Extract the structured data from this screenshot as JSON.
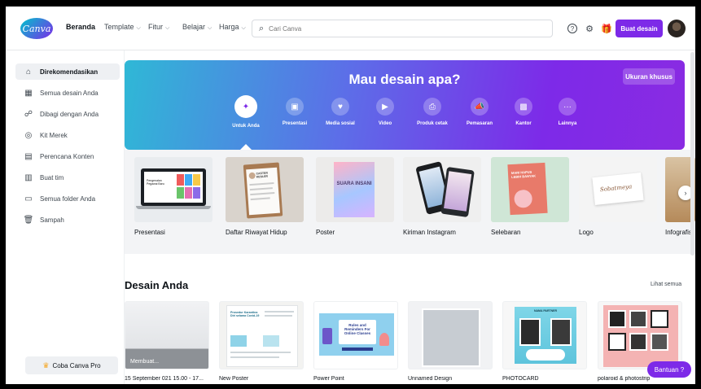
{
  "header": {
    "logo_text": "Canva",
    "nav": [
      {
        "label": "Beranda",
        "chev": ""
      },
      {
        "label": "Template",
        "chev": "⌵"
      },
      {
        "label": "Fitur",
        "chev": "⌵"
      },
      {
        "label": "Belajar",
        "chev": "⌵"
      },
      {
        "label": "Harga",
        "chev": "⌵"
      }
    ],
    "search_placeholder": "Cari Canva",
    "create_label": "Buat desain",
    "help_icon": "?",
    "settings_icon": "⚙",
    "gift_icon": "🎁"
  },
  "sidebar": {
    "items": [
      {
        "label": "Direkomendasikan",
        "icon": "⌂"
      },
      {
        "label": "Semua desain Anda",
        "icon": "▦"
      },
      {
        "label": "Dibagi dengan Anda",
        "icon": "☍"
      },
      {
        "label": "Kit Merek",
        "icon": "◎"
      },
      {
        "label": "Perencana Konten",
        "icon": "▤"
      },
      {
        "label": "Buat tim",
        "icon": "▥"
      },
      {
        "label": "Semua folder Anda",
        "icon": "▭"
      },
      {
        "label": "Sampah",
        "icon": "🗑"
      }
    ],
    "pro_label": "Coba Canva Pro",
    "pro_icon": "♛"
  },
  "hero": {
    "title": "Mau desain apa?",
    "custom_size": "Ukuran khusus",
    "categories": [
      {
        "label": "Untuk Anda",
        "icon": "✦"
      },
      {
        "label": "Presentasi",
        "icon": "▣"
      },
      {
        "label": "Media sosial",
        "icon": "♥"
      },
      {
        "label": "Video",
        "icon": "▶"
      },
      {
        "label": "Produk cetak",
        "icon": "⎙"
      },
      {
        "label": "Pemasaran",
        "icon": "📣"
      },
      {
        "label": "Kantor",
        "icon": "▩"
      },
      {
        "label": "Lainnya",
        "icon": "···"
      }
    ]
  },
  "templates": {
    "items": [
      {
        "label": "Presentasi"
      },
      {
        "label": "Daftar Riwayat Hidup"
      },
      {
        "label": "Poster"
      },
      {
        "label": "Kiriman Instagram"
      },
      {
        "label": "Selebaran"
      },
      {
        "label": "Logo"
      },
      {
        "label": "Infografis"
      }
    ],
    "next_icon": "›"
  },
  "designs": {
    "title": "Desain Anda",
    "see_all": "Lihat semua",
    "loading_label": "Membuat...",
    "items": [
      {
        "label": "15 September 021 15.00 - 17..."
      },
      {
        "label": "New Poster"
      },
      {
        "label": "Power Point"
      },
      {
        "label": "Unnamed Design"
      },
      {
        "label": "PHOTOCARD"
      },
      {
        "label": "polaroid & photostrip"
      }
    ]
  },
  "thumb_text": {
    "presentasi": "Pengenalan Pegawai Baru",
    "cv": "CASTER KESLER",
    "poster": "SUARA INSANI",
    "selebaran": "MARI HAPUS LEBIH BANYAK",
    "logo": "Sobatmeya",
    "new_poster_1": "Prosedur Karantina Diri selama Covid-19",
    "powerpoint_1": "Rules and Reminders For Online Classes",
    "photocard_1": "NAMA PARTNER"
  },
  "help_label": "Bantuan ?",
  "colors": {
    "accent": "#7d2ae8",
    "hero_start": "#2fb8d6",
    "hero_end": "#8a2be2"
  }
}
